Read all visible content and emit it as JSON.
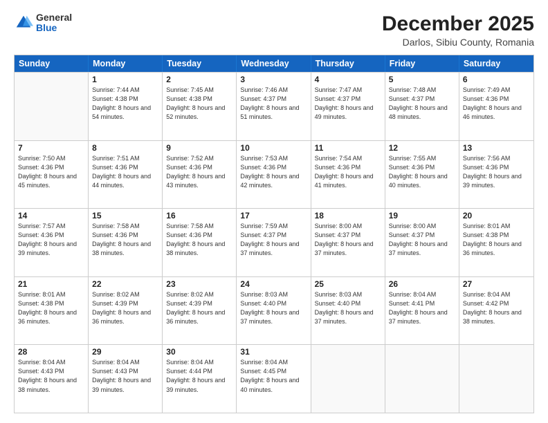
{
  "header": {
    "logo": {
      "general": "General",
      "blue": "Blue"
    },
    "title": "December 2025",
    "subtitle": "Darlos, Sibiu County, Romania"
  },
  "calendar": {
    "days_of_week": [
      "Sunday",
      "Monday",
      "Tuesday",
      "Wednesday",
      "Thursday",
      "Friday",
      "Saturday"
    ],
    "weeks": [
      [
        {
          "day": "",
          "empty": true
        },
        {
          "day": "1",
          "sunrise": "7:44 AM",
          "sunset": "4:38 PM",
          "daylight": "8 hours and 54 minutes."
        },
        {
          "day": "2",
          "sunrise": "7:45 AM",
          "sunset": "4:38 PM",
          "daylight": "8 hours and 52 minutes."
        },
        {
          "day": "3",
          "sunrise": "7:46 AM",
          "sunset": "4:37 PM",
          "daylight": "8 hours and 51 minutes."
        },
        {
          "day": "4",
          "sunrise": "7:47 AM",
          "sunset": "4:37 PM",
          "daylight": "8 hours and 49 minutes."
        },
        {
          "day": "5",
          "sunrise": "7:48 AM",
          "sunset": "4:37 PM",
          "daylight": "8 hours and 48 minutes."
        },
        {
          "day": "6",
          "sunrise": "7:49 AM",
          "sunset": "4:36 PM",
          "daylight": "8 hours and 46 minutes."
        }
      ],
      [
        {
          "day": "7",
          "sunrise": "7:50 AM",
          "sunset": "4:36 PM",
          "daylight": "8 hours and 45 minutes."
        },
        {
          "day": "8",
          "sunrise": "7:51 AM",
          "sunset": "4:36 PM",
          "daylight": "8 hours and 44 minutes."
        },
        {
          "day": "9",
          "sunrise": "7:52 AM",
          "sunset": "4:36 PM",
          "daylight": "8 hours and 43 minutes."
        },
        {
          "day": "10",
          "sunrise": "7:53 AM",
          "sunset": "4:36 PM",
          "daylight": "8 hours and 42 minutes."
        },
        {
          "day": "11",
          "sunrise": "7:54 AM",
          "sunset": "4:36 PM",
          "daylight": "8 hours and 41 minutes."
        },
        {
          "day": "12",
          "sunrise": "7:55 AM",
          "sunset": "4:36 PM",
          "daylight": "8 hours and 40 minutes."
        },
        {
          "day": "13",
          "sunrise": "7:56 AM",
          "sunset": "4:36 PM",
          "daylight": "8 hours and 39 minutes."
        }
      ],
      [
        {
          "day": "14",
          "sunrise": "7:57 AM",
          "sunset": "4:36 PM",
          "daylight": "8 hours and 39 minutes."
        },
        {
          "day": "15",
          "sunrise": "7:58 AM",
          "sunset": "4:36 PM",
          "daylight": "8 hours and 38 minutes."
        },
        {
          "day": "16",
          "sunrise": "7:58 AM",
          "sunset": "4:36 PM",
          "daylight": "8 hours and 38 minutes."
        },
        {
          "day": "17",
          "sunrise": "7:59 AM",
          "sunset": "4:37 PM",
          "daylight": "8 hours and 37 minutes."
        },
        {
          "day": "18",
          "sunrise": "8:00 AM",
          "sunset": "4:37 PM",
          "daylight": "8 hours and 37 minutes."
        },
        {
          "day": "19",
          "sunrise": "8:00 AM",
          "sunset": "4:37 PM",
          "daylight": "8 hours and 37 minutes."
        },
        {
          "day": "20",
          "sunrise": "8:01 AM",
          "sunset": "4:38 PM",
          "daylight": "8 hours and 36 minutes."
        }
      ],
      [
        {
          "day": "21",
          "sunrise": "8:01 AM",
          "sunset": "4:38 PM",
          "daylight": "8 hours and 36 minutes."
        },
        {
          "day": "22",
          "sunrise": "8:02 AM",
          "sunset": "4:39 PM",
          "daylight": "8 hours and 36 minutes."
        },
        {
          "day": "23",
          "sunrise": "8:02 AM",
          "sunset": "4:39 PM",
          "daylight": "8 hours and 36 minutes."
        },
        {
          "day": "24",
          "sunrise": "8:03 AM",
          "sunset": "4:40 PM",
          "daylight": "8 hours and 37 minutes."
        },
        {
          "day": "25",
          "sunrise": "8:03 AM",
          "sunset": "4:40 PM",
          "daylight": "8 hours and 37 minutes."
        },
        {
          "day": "26",
          "sunrise": "8:04 AM",
          "sunset": "4:41 PM",
          "daylight": "8 hours and 37 minutes."
        },
        {
          "day": "27",
          "sunrise": "8:04 AM",
          "sunset": "4:42 PM",
          "daylight": "8 hours and 38 minutes."
        }
      ],
      [
        {
          "day": "28",
          "sunrise": "8:04 AM",
          "sunset": "4:43 PM",
          "daylight": "8 hours and 38 minutes."
        },
        {
          "day": "29",
          "sunrise": "8:04 AM",
          "sunset": "4:43 PM",
          "daylight": "8 hours and 39 minutes."
        },
        {
          "day": "30",
          "sunrise": "8:04 AM",
          "sunset": "4:44 PM",
          "daylight": "8 hours and 39 minutes."
        },
        {
          "day": "31",
          "sunrise": "8:04 AM",
          "sunset": "4:45 PM",
          "daylight": "8 hours and 40 minutes."
        },
        {
          "day": "",
          "empty": true
        },
        {
          "day": "",
          "empty": true
        },
        {
          "day": "",
          "empty": true
        }
      ]
    ]
  }
}
